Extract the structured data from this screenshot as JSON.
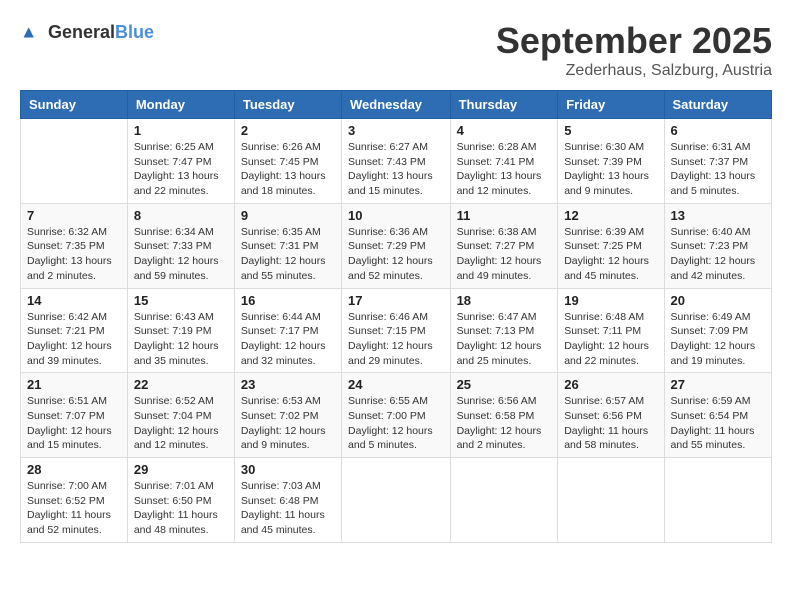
{
  "logo": {
    "text_general": "General",
    "text_blue": "Blue"
  },
  "header": {
    "month": "September 2025",
    "location": "Zederhaus, Salzburg, Austria"
  },
  "days_of_week": [
    "Sunday",
    "Monday",
    "Tuesday",
    "Wednesday",
    "Thursday",
    "Friday",
    "Saturday"
  ],
  "weeks": [
    [
      {
        "day": "",
        "info": ""
      },
      {
        "day": "1",
        "info": "Sunrise: 6:25 AM\nSunset: 7:47 PM\nDaylight: 13 hours\nand 22 minutes."
      },
      {
        "day": "2",
        "info": "Sunrise: 6:26 AM\nSunset: 7:45 PM\nDaylight: 13 hours\nand 18 minutes."
      },
      {
        "day": "3",
        "info": "Sunrise: 6:27 AM\nSunset: 7:43 PM\nDaylight: 13 hours\nand 15 minutes."
      },
      {
        "day": "4",
        "info": "Sunrise: 6:28 AM\nSunset: 7:41 PM\nDaylight: 13 hours\nand 12 minutes."
      },
      {
        "day": "5",
        "info": "Sunrise: 6:30 AM\nSunset: 7:39 PM\nDaylight: 13 hours\nand 9 minutes."
      },
      {
        "day": "6",
        "info": "Sunrise: 6:31 AM\nSunset: 7:37 PM\nDaylight: 13 hours\nand 5 minutes."
      }
    ],
    [
      {
        "day": "7",
        "info": "Sunrise: 6:32 AM\nSunset: 7:35 PM\nDaylight: 13 hours\nand 2 minutes."
      },
      {
        "day": "8",
        "info": "Sunrise: 6:34 AM\nSunset: 7:33 PM\nDaylight: 12 hours\nand 59 minutes."
      },
      {
        "day": "9",
        "info": "Sunrise: 6:35 AM\nSunset: 7:31 PM\nDaylight: 12 hours\nand 55 minutes."
      },
      {
        "day": "10",
        "info": "Sunrise: 6:36 AM\nSunset: 7:29 PM\nDaylight: 12 hours\nand 52 minutes."
      },
      {
        "day": "11",
        "info": "Sunrise: 6:38 AM\nSunset: 7:27 PM\nDaylight: 12 hours\nand 49 minutes."
      },
      {
        "day": "12",
        "info": "Sunrise: 6:39 AM\nSunset: 7:25 PM\nDaylight: 12 hours\nand 45 minutes."
      },
      {
        "day": "13",
        "info": "Sunrise: 6:40 AM\nSunset: 7:23 PM\nDaylight: 12 hours\nand 42 minutes."
      }
    ],
    [
      {
        "day": "14",
        "info": "Sunrise: 6:42 AM\nSunset: 7:21 PM\nDaylight: 12 hours\nand 39 minutes."
      },
      {
        "day": "15",
        "info": "Sunrise: 6:43 AM\nSunset: 7:19 PM\nDaylight: 12 hours\nand 35 minutes."
      },
      {
        "day": "16",
        "info": "Sunrise: 6:44 AM\nSunset: 7:17 PM\nDaylight: 12 hours\nand 32 minutes."
      },
      {
        "day": "17",
        "info": "Sunrise: 6:46 AM\nSunset: 7:15 PM\nDaylight: 12 hours\nand 29 minutes."
      },
      {
        "day": "18",
        "info": "Sunrise: 6:47 AM\nSunset: 7:13 PM\nDaylight: 12 hours\nand 25 minutes."
      },
      {
        "day": "19",
        "info": "Sunrise: 6:48 AM\nSunset: 7:11 PM\nDaylight: 12 hours\nand 22 minutes."
      },
      {
        "day": "20",
        "info": "Sunrise: 6:49 AM\nSunset: 7:09 PM\nDaylight: 12 hours\nand 19 minutes."
      }
    ],
    [
      {
        "day": "21",
        "info": "Sunrise: 6:51 AM\nSunset: 7:07 PM\nDaylight: 12 hours\nand 15 minutes."
      },
      {
        "day": "22",
        "info": "Sunrise: 6:52 AM\nSunset: 7:04 PM\nDaylight: 12 hours\nand 12 minutes."
      },
      {
        "day": "23",
        "info": "Sunrise: 6:53 AM\nSunset: 7:02 PM\nDaylight: 12 hours\nand 9 minutes."
      },
      {
        "day": "24",
        "info": "Sunrise: 6:55 AM\nSunset: 7:00 PM\nDaylight: 12 hours\nand 5 minutes."
      },
      {
        "day": "25",
        "info": "Sunrise: 6:56 AM\nSunset: 6:58 PM\nDaylight: 12 hours\nand 2 minutes."
      },
      {
        "day": "26",
        "info": "Sunrise: 6:57 AM\nSunset: 6:56 PM\nDaylight: 11 hours\nand 58 minutes."
      },
      {
        "day": "27",
        "info": "Sunrise: 6:59 AM\nSunset: 6:54 PM\nDaylight: 11 hours\nand 55 minutes."
      }
    ],
    [
      {
        "day": "28",
        "info": "Sunrise: 7:00 AM\nSunset: 6:52 PM\nDaylight: 11 hours\nand 52 minutes."
      },
      {
        "day": "29",
        "info": "Sunrise: 7:01 AM\nSunset: 6:50 PM\nDaylight: 11 hours\nand 48 minutes."
      },
      {
        "day": "30",
        "info": "Sunrise: 7:03 AM\nSunset: 6:48 PM\nDaylight: 11 hours\nand 45 minutes."
      },
      {
        "day": "",
        "info": ""
      },
      {
        "day": "",
        "info": ""
      },
      {
        "day": "",
        "info": ""
      },
      {
        "day": "",
        "info": ""
      }
    ]
  ]
}
